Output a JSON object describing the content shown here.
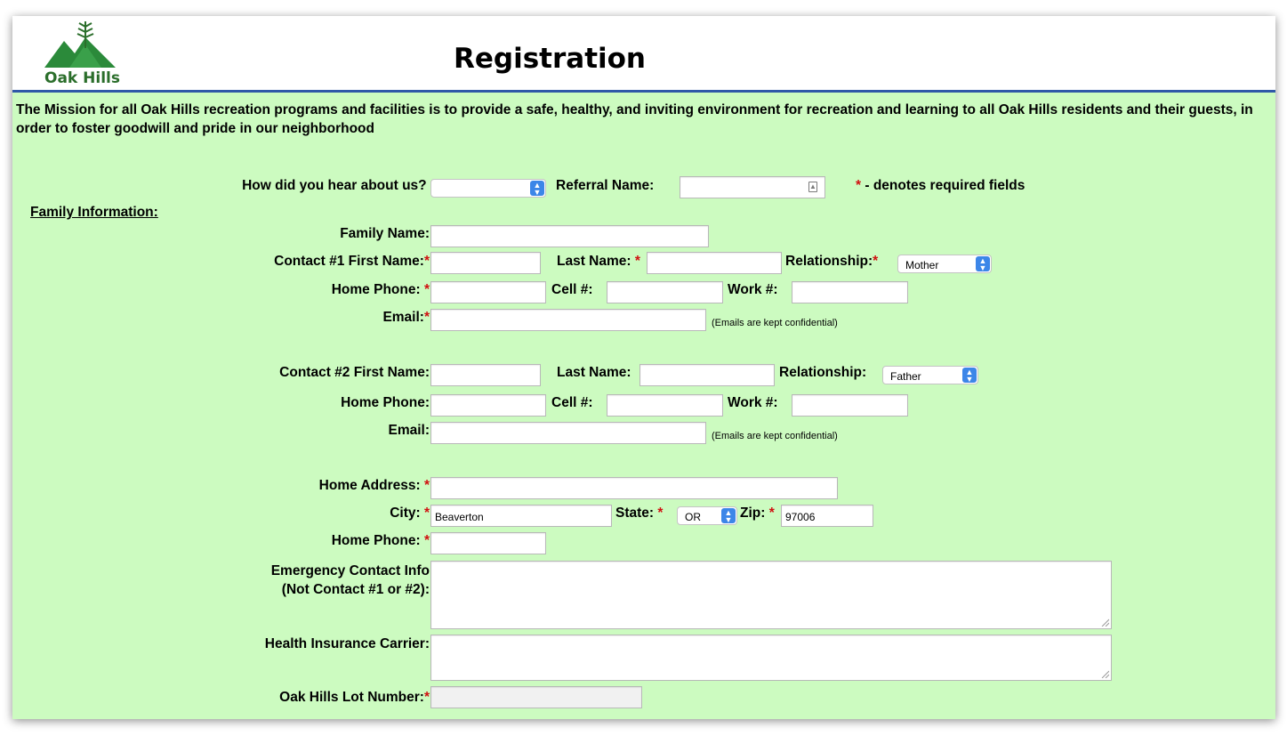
{
  "header": {
    "logo_text": "Oak Hills",
    "title": "Registration"
  },
  "mission": "The Mission for all Oak Hills recreation programs and facilities is to provide a safe, healthy, and inviting environment for recreation and learning to all Oak Hills residents and their guests, in order to foster goodwill and pride in our neighborhood",
  "referral": {
    "how_heard_label": "How did you hear about us?",
    "how_heard_value": "",
    "referral_name_label": "Referral Name:",
    "referral_name_value": "",
    "required_star": "*",
    "required_note": " - denotes required fields"
  },
  "family": {
    "section_label": "Family Information:",
    "family_name_label": "Family Name:",
    "family_name_value": ""
  },
  "contact1": {
    "first_name_label": "Contact #1 First Name:",
    "first_name_value": "",
    "last_name_label": "Last Name:",
    "last_name_value": "",
    "relationship_label": "Relationship:",
    "relationship_value": "Mother",
    "home_phone_label": "Home Phone:",
    "home_phone_value": "",
    "cell_label": "Cell #:",
    "cell_value": "",
    "work_label": "Work #:",
    "work_value": "",
    "email_label": "Email:",
    "email_value": "",
    "email_note": "(Emails are kept confidential)"
  },
  "contact2": {
    "first_name_label": "Contact #2 First Name:",
    "first_name_value": "",
    "last_name_label": "Last Name:",
    "last_name_value": "",
    "relationship_label": "Relationship:",
    "relationship_value": "Father",
    "home_phone_label": "Home Phone:",
    "home_phone_value": "",
    "cell_label": "Cell #:",
    "cell_value": "",
    "work_label": "Work #:",
    "work_value": "",
    "email_label": "Email:",
    "email_value": "",
    "email_note": "(Emails are kept confidential)"
  },
  "address": {
    "home_address_label": "Home Address:",
    "home_address_value": "",
    "city_label": "City:",
    "city_value": "Beaverton",
    "state_label": "State:",
    "state_value": "OR",
    "zip_label": "Zip:",
    "zip_value": "97006",
    "home_phone_label": "Home Phone:",
    "home_phone_value": ""
  },
  "emergency": {
    "label_line1": "Emergency Contact Info",
    "label_line2": "(Not Contact #1 or #2):",
    "value": ""
  },
  "insurance": {
    "label": "Health Insurance Carrier:",
    "value": ""
  },
  "lot": {
    "label": "Oak Hills Lot Number:",
    "value": ""
  },
  "colors": {
    "background": "#ccfbc0",
    "rule": "#2f58a8",
    "required": "#d01010",
    "logo": "#2b6e2b",
    "select_arrow": "#3c86e8"
  }
}
